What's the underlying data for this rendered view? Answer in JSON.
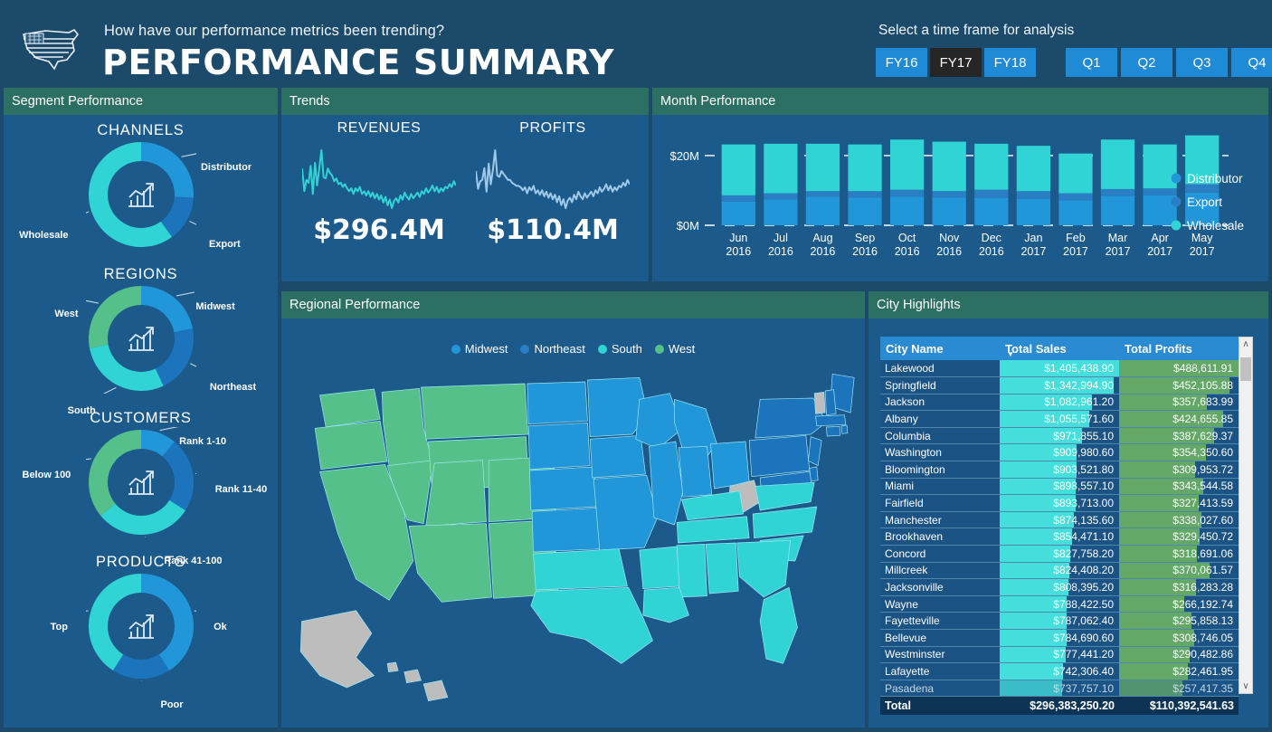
{
  "header": {
    "logo_icon": "usa-map-flag-icon",
    "question": "How have our performance metrics been trending?",
    "title": "PERFORMANCE SUMMARY",
    "timeframe_label": "Select a time frame for analysis",
    "fy_buttons": [
      {
        "label": "FY16",
        "selected": false
      },
      {
        "label": "FY17",
        "selected": true
      },
      {
        "label": "FY18",
        "selected": false
      }
    ],
    "quarter_buttons": [
      {
        "label": "Q1",
        "selected": false
      },
      {
        "label": "Q2",
        "selected": false
      },
      {
        "label": "Q3",
        "selected": false
      },
      {
        "label": "Q4",
        "selected": false
      }
    ]
  },
  "segment_panel": {
    "title": "Segment Performance",
    "donuts": [
      {
        "title": "CHANNELS",
        "center_icon": "bar-chart-growth-icon",
        "slices": [
          {
            "label": "Distributor",
            "value": 26,
            "color": "#2196d9"
          },
          {
            "label": "Export",
            "value": 14,
            "color": "#1c75bc"
          },
          {
            "label": "Wholesale",
            "value": 60,
            "color": "#31d4d4"
          }
        ]
      },
      {
        "title": "REGIONS",
        "center_icon": "bar-chart-growth-icon",
        "slices": [
          {
            "label": "Midwest",
            "value": 22,
            "color": "#2196d9"
          },
          {
            "label": "Northeast",
            "value": 21,
            "color": "#1c75bc"
          },
          {
            "label": "South",
            "value": 29,
            "color": "#31d4d4"
          },
          {
            "label": "West",
            "value": 28,
            "color": "#55c08a"
          }
        ]
      },
      {
        "title": "CUSTOMERS",
        "center_icon": "bar-chart-growth-icon",
        "slices": [
          {
            "label": "Rank 1-10",
            "value": 11,
            "color": "#2196d9"
          },
          {
            "label": "Rank 11-40",
            "value": 23,
            "color": "#1c75bc"
          },
          {
            "label": "Rank 41-100",
            "value": 30,
            "color": "#31d4d4"
          },
          {
            "label": "Below 100",
            "value": 36,
            "color": "#55c08a"
          }
        ]
      },
      {
        "title": "PRODUCTS",
        "center_icon": "bar-chart-growth-icon",
        "slices": [
          {
            "label": "Ok",
            "value": 41,
            "color": "#2196d9"
          },
          {
            "label": "Poor",
            "value": 18,
            "color": "#1c75bc"
          },
          {
            "label": "Top",
            "value": 41,
            "color": "#31d4d4"
          }
        ]
      }
    ]
  },
  "trends_panel": {
    "title": "Trends",
    "metrics": [
      {
        "name": "REVENUES",
        "value": "$296.4M",
        "line_color": "#31d4d4"
      },
      {
        "name": "PROFITS",
        "value": "$110.4M",
        "line_color": "#9ec9e8"
      }
    ],
    "revenue_spark": [
      62,
      30,
      46,
      42,
      66,
      26,
      70,
      38,
      62,
      88,
      50,
      48,
      62,
      56,
      52,
      44,
      48,
      40,
      42,
      36,
      40,
      34,
      30,
      34,
      26,
      34,
      30,
      36,
      26,
      30,
      24,
      30,
      22,
      28,
      20,
      26,
      18,
      24,
      14,
      22,
      10,
      18,
      6,
      16,
      20,
      14,
      24,
      18,
      28,
      22,
      18,
      26,
      20,
      24,
      28,
      22,
      30,
      26,
      34,
      28,
      32,
      38,
      30,
      36,
      28,
      34,
      30,
      36,
      34,
      40,
      36,
      44,
      38
    ],
    "profit_spark": [
      58,
      34,
      44,
      46,
      62,
      30,
      68,
      40,
      60,
      86,
      52,
      50,
      58,
      54,
      50,
      46,
      46,
      42,
      40,
      38,
      38,
      36,
      32,
      36,
      28,
      36,
      32,
      38,
      28,
      32,
      26,
      32,
      24,
      30,
      22,
      28,
      20,
      26,
      16,
      24,
      12,
      20,
      8,
      18,
      22,
      16,
      26,
      20,
      30,
      24,
      20,
      28,
      22,
      26,
      30,
      24,
      32,
      28,
      36,
      30,
      34,
      40,
      32,
      38,
      30,
      36,
      32,
      38,
      36,
      42,
      38,
      46,
      40
    ]
  },
  "month_panel": {
    "title": "Month Performance",
    "legend": [
      {
        "label": "Distributor",
        "color": "#2196d9"
      },
      {
        "label": "Export",
        "color": "#2a7fc4"
      },
      {
        "label": "Wholesale",
        "color": "#31d4d4"
      }
    ]
  },
  "regional_panel": {
    "title": "Regional Performance",
    "legend": [
      {
        "label": "Midwest",
        "color": "#2196d9"
      },
      {
        "label": "Northeast",
        "color": "#1c75bc"
      },
      {
        "label": "South",
        "color": "#31d4d4"
      },
      {
        "label": "West",
        "color": "#55c08a"
      }
    ],
    "unassigned_color": "#bdbdbd"
  },
  "city_panel": {
    "title": "City Highlights",
    "columns": [
      "City Name",
      "Total Sales",
      "Total Profits"
    ],
    "sort_column": "Total Sales",
    "sort_direction": "descending",
    "sales_bar_color": "#46dedd",
    "profit_bar_color": "#63a866",
    "rows": [
      {
        "city": "Lakewood",
        "sales": "$1,405,438.90",
        "profits": "$488,611.91",
        "sales_num": 1405438.9,
        "profits_num": 488611.91
      },
      {
        "city": "Springfield",
        "sales": "$1,342,994.90",
        "profits": "$452,105.88",
        "sales_num": 1342994.9,
        "profits_num": 452105.88
      },
      {
        "city": "Jackson",
        "sales": "$1,082,961.20",
        "profits": "$357,683.99",
        "sales_num": 1082961.2,
        "profits_num": 357683.99
      },
      {
        "city": "Albany",
        "sales": "$1,055,571.60",
        "profits": "$424,655.85",
        "sales_num": 1055571.6,
        "profits_num": 424655.85
      },
      {
        "city": "Columbia",
        "sales": "$971,855.10",
        "profits": "$387,629.37",
        "sales_num": 971855.1,
        "profits_num": 387629.37
      },
      {
        "city": "Washington",
        "sales": "$909,980.60",
        "profits": "$354,350.60",
        "sales_num": 909980.6,
        "profits_num": 354350.6
      },
      {
        "city": "Bloomington",
        "sales": "$903,521.80",
        "profits": "$309,953.72",
        "sales_num": 903521.8,
        "profits_num": 309953.72
      },
      {
        "city": "Miami",
        "sales": "$898,557.10",
        "profits": "$343,544.58",
        "sales_num": 898557.1,
        "profits_num": 343544.58
      },
      {
        "city": "Fairfield",
        "sales": "$893,713.00",
        "profits": "$327,413.59",
        "sales_num": 893713.0,
        "profits_num": 327413.59
      },
      {
        "city": "Manchester",
        "sales": "$874,135.60",
        "profits": "$338,027.60",
        "sales_num": 874135.6,
        "profits_num": 338027.6
      },
      {
        "city": "Brookhaven",
        "sales": "$854,471.10",
        "profits": "$329,450.72",
        "sales_num": 854471.1,
        "profits_num": 329450.72
      },
      {
        "city": "Concord",
        "sales": "$827,758.20",
        "profits": "$318,691.06",
        "sales_num": 827758.2,
        "profits_num": 318691.06
      },
      {
        "city": "Millcreek",
        "sales": "$824,408.20",
        "profits": "$370,061.57",
        "sales_num": 824408.2,
        "profits_num": 370061.57
      },
      {
        "city": "Jacksonville",
        "sales": "$808,395.20",
        "profits": "$316,283.28",
        "sales_num": 808395.2,
        "profits_num": 316283.28
      },
      {
        "city": "Wayne",
        "sales": "$788,422.50",
        "profits": "$266,192.74",
        "sales_num": 788422.5,
        "profits_num": 266192.74
      },
      {
        "city": "Fayetteville",
        "sales": "$787,062.40",
        "profits": "$295,858.13",
        "sales_num": 787062.4,
        "profits_num": 295858.13
      },
      {
        "city": "Bellevue",
        "sales": "$784,690.60",
        "profits": "$308,746.05",
        "sales_num": 784690.6,
        "profits_num": 308746.05
      },
      {
        "city": "Westminster",
        "sales": "$777,441.20",
        "profits": "$290,482.86",
        "sales_num": 777441.2,
        "profits_num": 290482.86
      },
      {
        "city": "Lafayette",
        "sales": "$742,306.40",
        "profits": "$282,461.95",
        "sales_num": 742306.4,
        "profits_num": 282461.95
      },
      {
        "city": "Pasadena",
        "sales": "$737,757.10",
        "profits": "$257,417.35",
        "sales_num": 737757.1,
        "profits_num": 257417.35
      }
    ],
    "total_row": {
      "label": "Total",
      "sales": "$296,383,250.20",
      "profits": "$110,392,541.63"
    }
  },
  "chart_data": [
    {
      "type": "bar",
      "title": "Month Performance",
      "stacked": true,
      "xlabel": "",
      "ylabel": "",
      "ylim": [
        0,
        27
      ],
      "ytick_labels": [
        "$0M",
        "$20M"
      ],
      "ytick_values": [
        0,
        20
      ],
      "categories": [
        "Jun 2016",
        "Jul 2016",
        "Aug 2016",
        "Sep 2016",
        "Oct 2016",
        "Nov 2016",
        "Dec 2016",
        "Jan 2017",
        "Feb 2017",
        "Mar 2017",
        "Apr 2017",
        "May 2017"
      ],
      "series": [
        {
          "name": "Distributor",
          "color": "#2196d9",
          "values": [
            6.8,
            7.4,
            8.2,
            8.0,
            8.2,
            8.0,
            7.8,
            7.6,
            7.2,
            8.4,
            8.6,
            9.4
          ]
        },
        {
          "name": "Export",
          "color": "#2a7fc4",
          "values": [
            1.8,
            1.8,
            1.6,
            1.8,
            2.0,
            1.8,
            2.4,
            2.2,
            2.0,
            2.0,
            2.0,
            2.4
          ]
        },
        {
          "name": "Wholesale",
          "color": "#31d4d4",
          "values": [
            14.6,
            14.2,
            13.6,
            13.4,
            14.4,
            14.2,
            13.2,
            13.0,
            11.4,
            14.2,
            12.6,
            14.0
          ]
        }
      ],
      "legend_position": "right",
      "grid": false
    },
    {
      "type": "pie",
      "title": "CHANNELS",
      "labels": [
        "Distributor",
        "Export",
        "Wholesale"
      ],
      "values": [
        26,
        14,
        60
      ],
      "colors": [
        "#2196d9",
        "#1c75bc",
        "#31d4d4"
      ]
    },
    {
      "type": "pie",
      "title": "REGIONS",
      "labels": [
        "Midwest",
        "Northeast",
        "South",
        "West"
      ],
      "values": [
        22,
        21,
        29,
        28
      ],
      "colors": [
        "#2196d9",
        "#1c75bc",
        "#31d4d4",
        "#55c08a"
      ]
    },
    {
      "type": "pie",
      "title": "CUSTOMERS",
      "labels": [
        "Rank 1-10",
        "Rank 11-40",
        "Rank 41-100",
        "Below 100"
      ],
      "values": [
        11,
        23,
        30,
        36
      ],
      "colors": [
        "#2196d9",
        "#1c75bc",
        "#31d4d4",
        "#55c08a"
      ]
    },
    {
      "type": "pie",
      "title": "PRODUCTS",
      "labels": [
        "Ok",
        "Poor",
        "Top"
      ],
      "values": [
        41,
        18,
        41
      ],
      "colors": [
        "#2196d9",
        "#1c75bc",
        "#31d4d4"
      ]
    },
    {
      "type": "line",
      "title": "REVENUES",
      "annotation": "$296.4M",
      "series": [
        {
          "name": "Revenues",
          "color": "#31d4d4"
        }
      ]
    },
    {
      "type": "line",
      "title": "PROFITS",
      "annotation": "$110.4M",
      "series": [
        {
          "name": "Profits",
          "color": "#9ec9e8"
        }
      ]
    },
    {
      "type": "table",
      "title": "City Highlights",
      "columns": [
        "City Name",
        "Total Sales",
        "Total Profits"
      ],
      "rows": [
        [
          "Lakewood",
          "$1,405,438.90",
          "$488,611.91"
        ],
        [
          "Springfield",
          "$1,342,994.90",
          "$452,105.88"
        ],
        [
          "Jackson",
          "$1,082,961.20",
          "$357,683.99"
        ],
        [
          "Albany",
          "$1,055,571.60",
          "$424,655.85"
        ],
        [
          "Columbia",
          "$971,855.10",
          "$387,629.37"
        ],
        [
          "Washington",
          "$909,980.60",
          "$354,350.60"
        ],
        [
          "Bloomington",
          "$903,521.80",
          "$309,953.72"
        ],
        [
          "Miami",
          "$898,557.10",
          "$343,544.58"
        ],
        [
          "Fairfield",
          "$893,713.00",
          "$327,413.59"
        ],
        [
          "Manchester",
          "$874,135.60",
          "$338,027.60"
        ],
        [
          "Brookhaven",
          "$854,471.10",
          "$329,450.72"
        ],
        [
          "Concord",
          "$827,758.20",
          "$318,691.06"
        ],
        [
          "Millcreek",
          "$824,408.20",
          "$370,061.57"
        ],
        [
          "Jacksonville",
          "$808,395.20",
          "$316,283.28"
        ],
        [
          "Wayne",
          "$788,422.50",
          "$266,192.74"
        ],
        [
          "Fayetteville",
          "$787,062.40",
          "$295,858.13"
        ],
        [
          "Bellevue",
          "$784,690.60",
          "$308,746.05"
        ],
        [
          "Westminster",
          "$777,441.20",
          "$290,482.86"
        ],
        [
          "Lafayette",
          "$742,306.40",
          "$282,461.95"
        ],
        [
          "Pasadena",
          "$737,757.10",
          "$257,417.35"
        ]
      ],
      "total": [
        "Total",
        "$296,383,250.20",
        "$110,392,541.63"
      ]
    }
  ]
}
